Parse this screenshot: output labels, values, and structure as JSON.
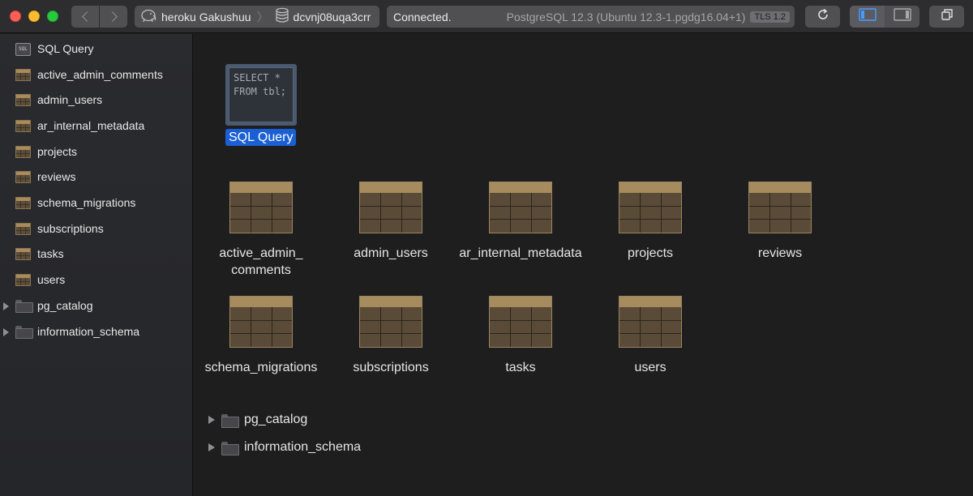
{
  "toolbar": {
    "breadcrumb": {
      "connection": "heroku Gakushuu",
      "database": "dcvnj08uqa3crr"
    },
    "status": {
      "state": "Connected.",
      "server": "PostgreSQL 12.3 (Ubuntu 12.3-1.pgdg16.04+1)",
      "tls": "TLS 1.2"
    }
  },
  "sidebar": {
    "items": [
      {
        "label": "SQL Query",
        "icon": "sql-query-icon"
      },
      {
        "label": "active_admin_comments",
        "icon": "table-icon"
      },
      {
        "label": "admin_users",
        "icon": "table-icon"
      },
      {
        "label": "ar_internal_metadata",
        "icon": "table-icon"
      },
      {
        "label": "projects",
        "icon": "table-icon"
      },
      {
        "label": "reviews",
        "icon": "table-icon"
      },
      {
        "label": "schema_migrations",
        "icon": "table-icon"
      },
      {
        "label": "subscriptions",
        "icon": "table-icon"
      },
      {
        "label": "tasks",
        "icon": "table-icon"
      },
      {
        "label": "users",
        "icon": "table-icon"
      },
      {
        "label": "pg_catalog",
        "icon": "folder-icon"
      },
      {
        "label": "information_schema",
        "icon": "folder-icon"
      }
    ]
  },
  "main": {
    "sql_query": {
      "preview": "SELECT *\nFROM tbl;",
      "label": "SQL Query"
    },
    "tables": [
      {
        "name": "active_admin_\ncomments"
      },
      {
        "name": "admin_users"
      },
      {
        "name": "ar_internal_metadata"
      },
      {
        "name": "projects"
      },
      {
        "name": "reviews"
      },
      {
        "name": "schema_migrations"
      },
      {
        "name": "subscriptions"
      },
      {
        "name": "tasks"
      },
      {
        "name": "users"
      }
    ],
    "schemas": [
      {
        "name": "pg_catalog"
      },
      {
        "name": "information_schema"
      }
    ]
  },
  "colors": {
    "selection": "#1a5fd3",
    "table_header": "#a68b5e",
    "table_body": "#594b37"
  }
}
